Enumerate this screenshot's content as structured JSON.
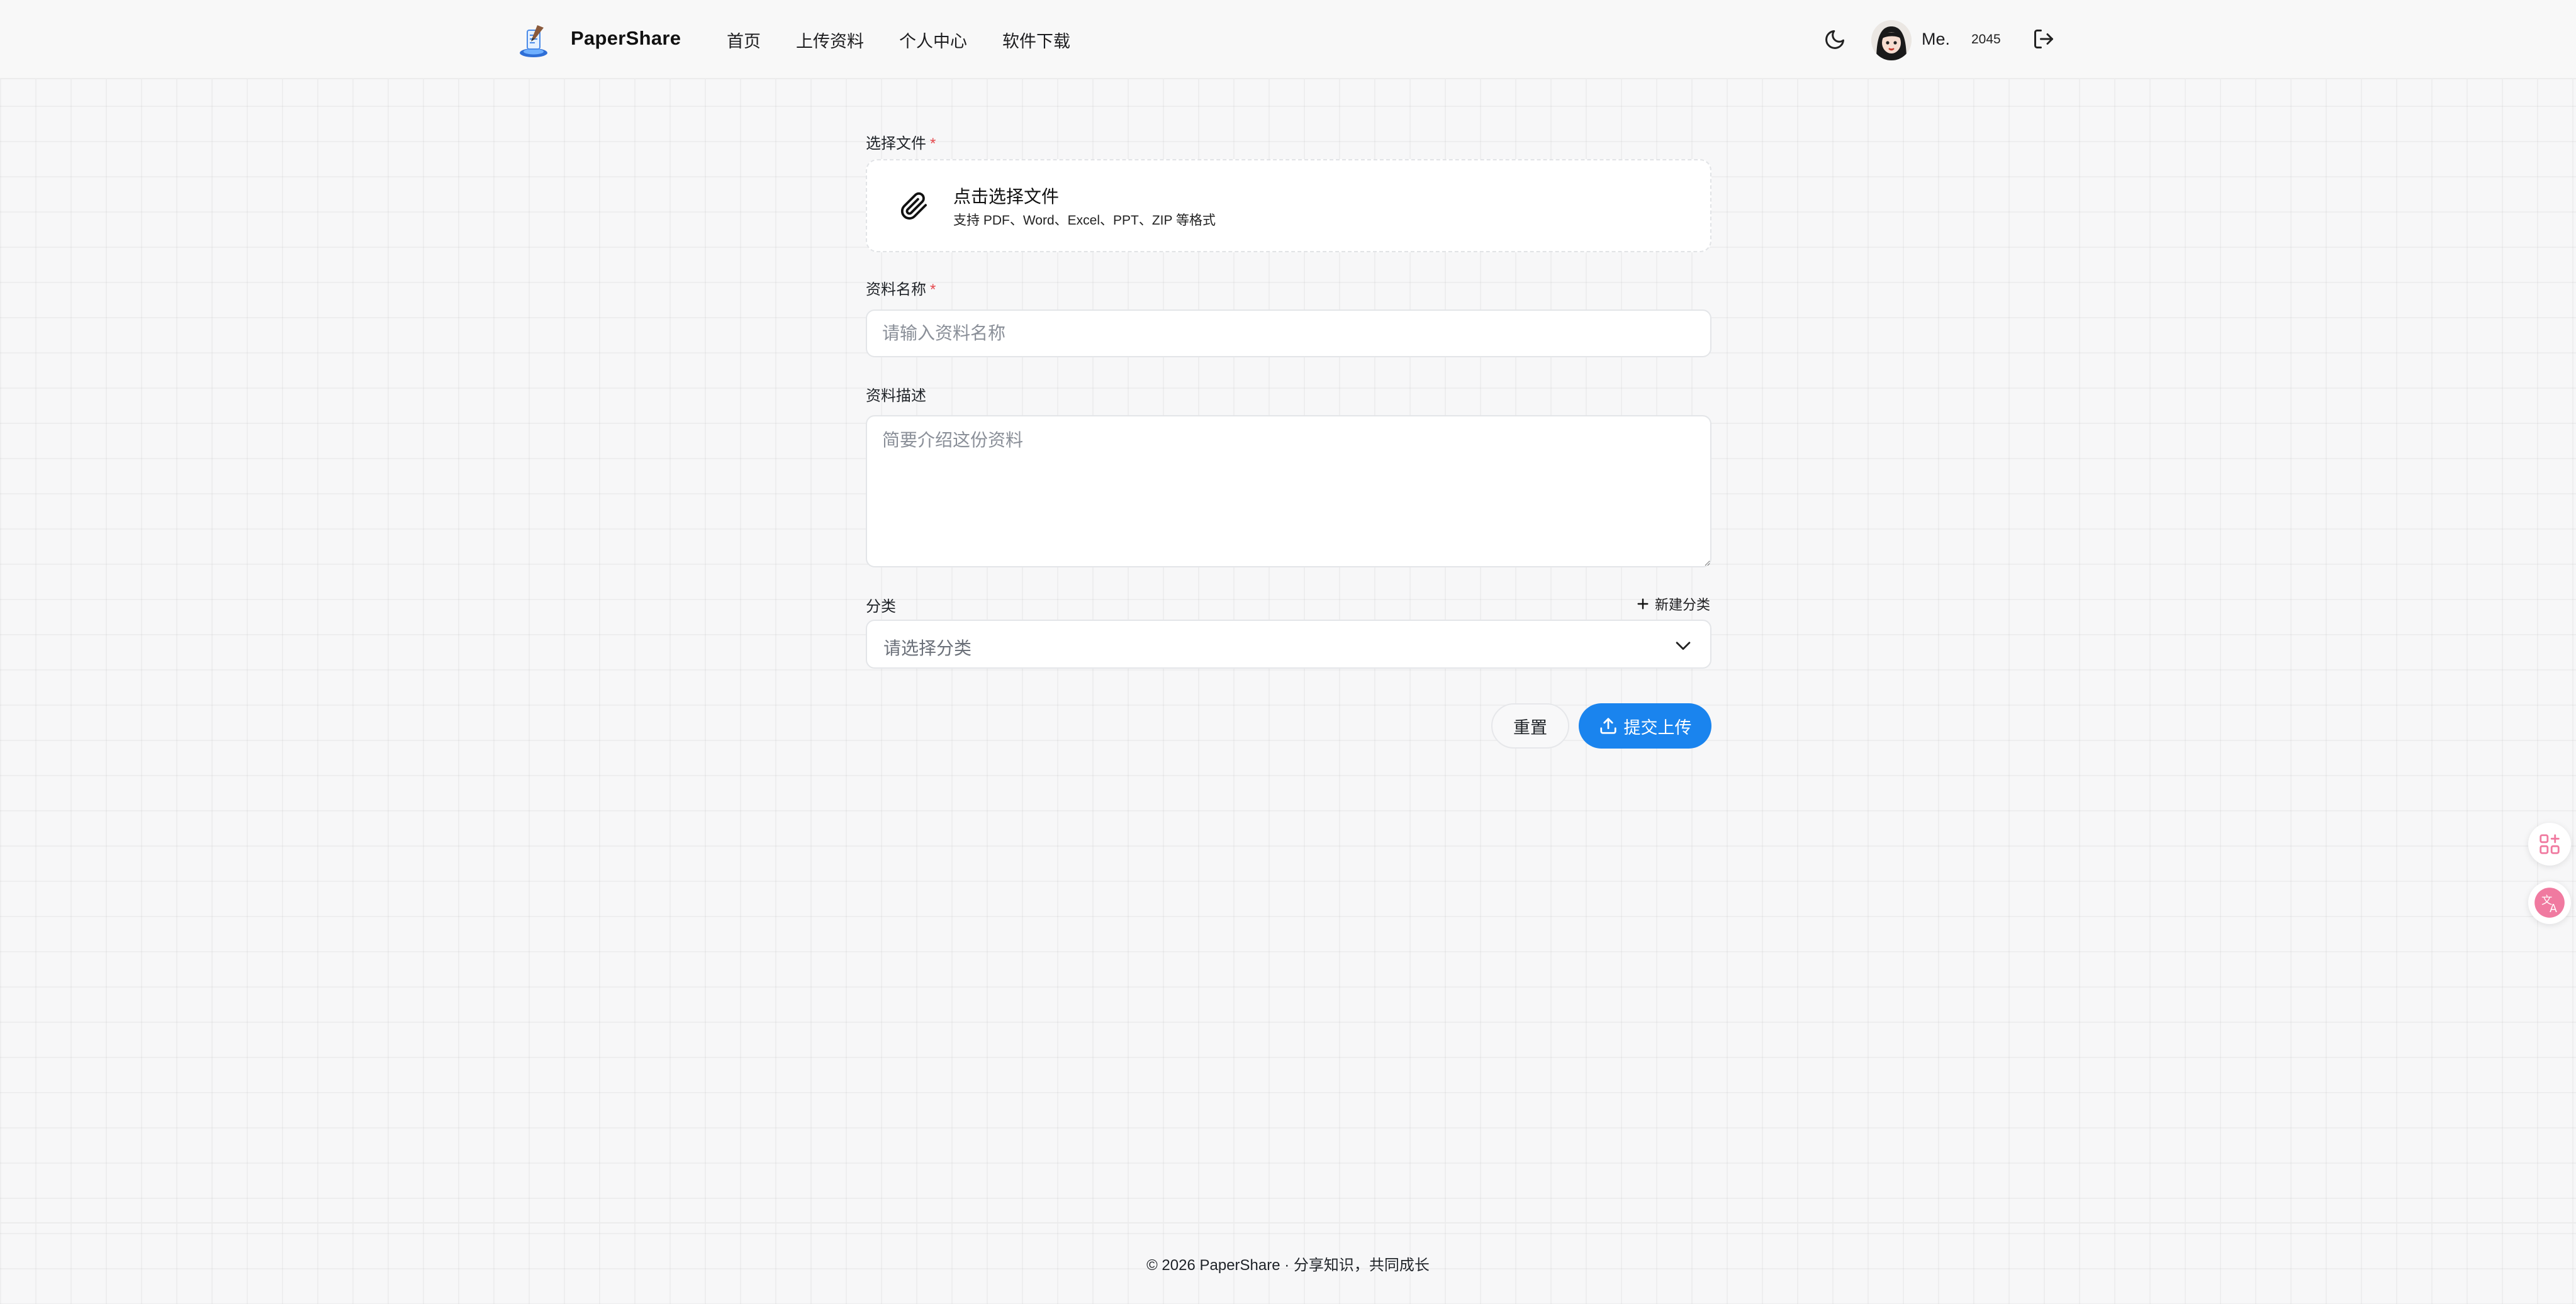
{
  "header": {
    "brand": "PaperShare",
    "nav": [
      "首页",
      "上传资料",
      "个人中心",
      "软件下载"
    ],
    "user": {
      "name": "Me.",
      "badge": "2045"
    },
    "icons": {
      "theme": "moon-icon",
      "logout": "logout-icon"
    }
  },
  "form": {
    "file": {
      "label": "选择文件",
      "required_mark": "*",
      "title": "点击选择文件",
      "hint": "支持 PDF、Word、Excel、PPT、ZIP 等格式"
    },
    "name": {
      "label": "资料名称",
      "required_mark": "*",
      "value": "",
      "placeholder": "请输入资料名称"
    },
    "description": {
      "label": "资料描述",
      "value": "",
      "placeholder": "简要介绍这份资料"
    },
    "category": {
      "label": "分类",
      "new_label": "新建分类",
      "selected": "请选择分类"
    },
    "actions": {
      "reset": "重置",
      "submit": "提交上传"
    }
  },
  "footer": {
    "text": "© 2026 PaperShare · 分享知识，共同成长"
  },
  "colors": {
    "primary": "#1a84ee",
    "required": "#e5484d",
    "float_accent": "#f07aa0"
  }
}
